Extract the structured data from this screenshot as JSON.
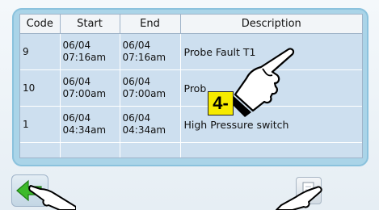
{
  "table": {
    "headers": [
      "Code",
      "Start",
      "End",
      "Description"
    ],
    "rows": [
      {
        "code": "9",
        "start_date": "06/04",
        "start_time": "07:16am",
        "end_date": "06/04",
        "end_time": "07:16am",
        "description": "Probe Fault T1"
      },
      {
        "code": "10",
        "start_date": "06/04",
        "start_time": "07:00am",
        "end_date": "06/04",
        "end_time": "07:00am",
        "description": "Prob"
      },
      {
        "code": "1",
        "start_date": "06/04",
        "start_time": "04:34am",
        "end_date": "06/04",
        "end_time": "04:34am",
        "description": "High Pressure switch"
      }
    ]
  },
  "annotation": {
    "step_label": "4-"
  },
  "icons": {
    "back": "green-left-arrow-icon",
    "document": "document-icon",
    "pointer": "pointing-hand-icon"
  },
  "colors": {
    "panel": "#aad4e8",
    "table_bg": "#cddfef",
    "badge": "#f6ea00",
    "arrow": "#3dba2a"
  }
}
